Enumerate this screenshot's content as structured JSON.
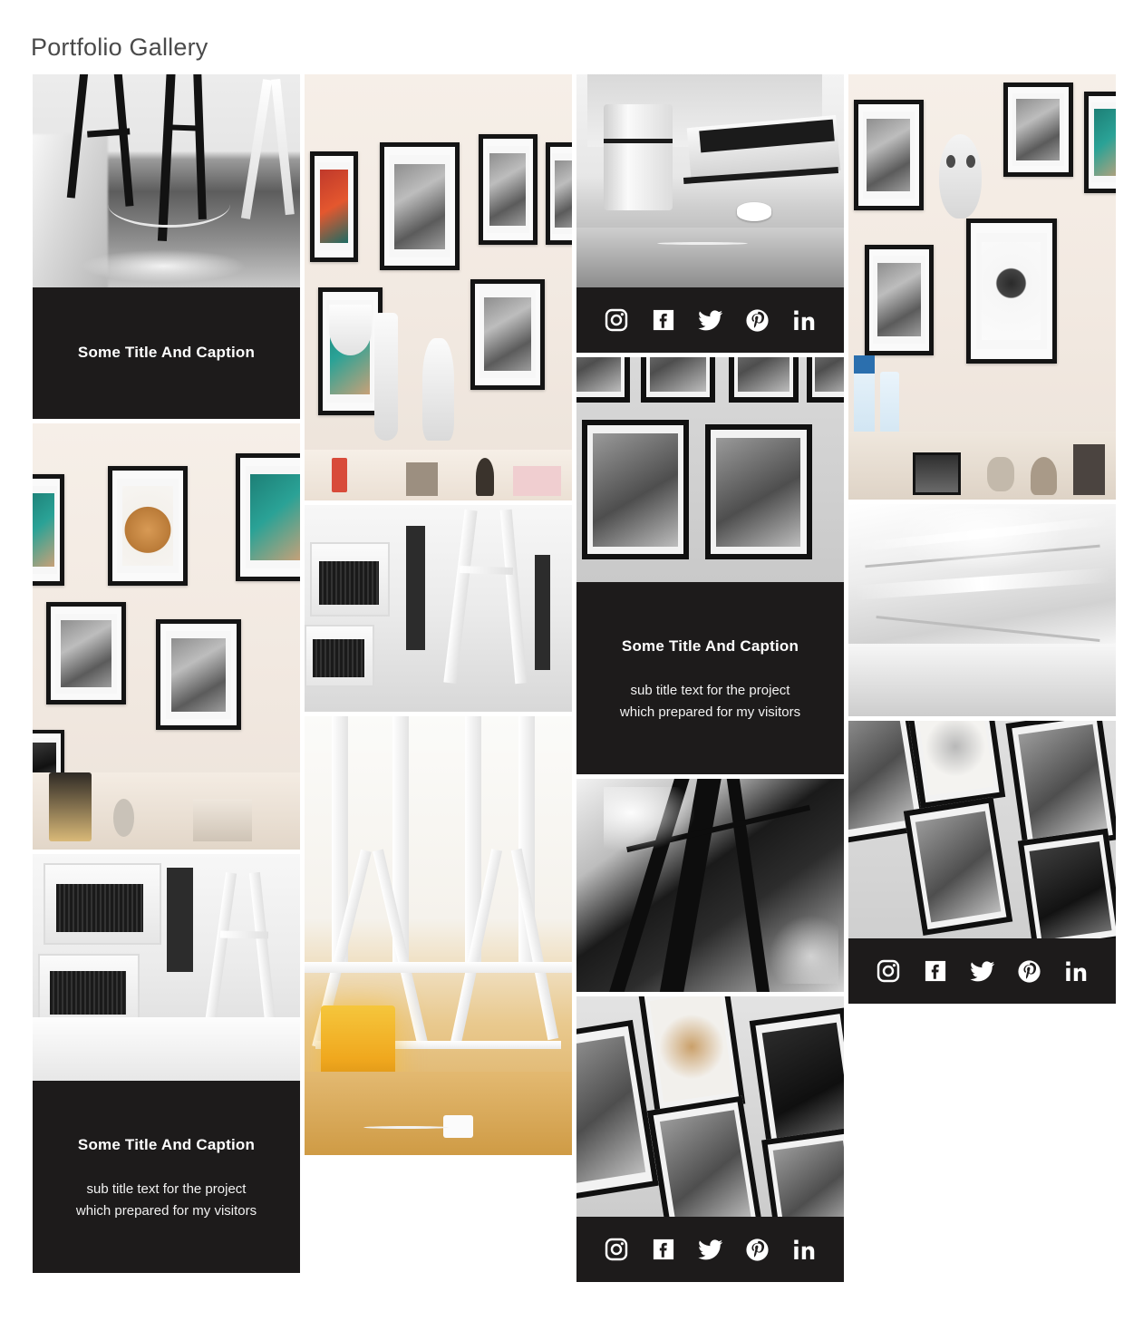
{
  "page": {
    "title": "Portfolio Gallery",
    "background_color": "#ffffff",
    "title_color": "#4a4a4a",
    "overlay_color": "#1d1b1b",
    "overlay_text_color": "#ffffff"
  },
  "caption": {
    "title": "Some Title And Caption",
    "subtitle_line1": "sub title text for the project",
    "subtitle_line2": "which prepared for my visitors"
  },
  "social": {
    "items": [
      {
        "name": "instagram-icon",
        "label": "Instagram"
      },
      {
        "name": "facebook-icon",
        "label": "Facebook"
      },
      {
        "name": "twitter-icon",
        "label": "Twitter"
      },
      {
        "name": "pinterest-icon",
        "label": "Pinterest"
      },
      {
        "name": "linkedin-icon",
        "label": "LinkedIn"
      }
    ]
  },
  "gallery": {
    "columns": [
      {
        "index": 1,
        "items": [
          {
            "type": "image-with-caption",
            "alt": "Black and white photo of stool legs and cable on a wooden floor",
            "overlay": "caption-title-only"
          },
          {
            "type": "image",
            "alt": "Gallery wall with motorcycle posters, gloves print and Moto Hero magazine"
          },
          {
            "type": "image-with-caption",
            "alt": "Black and white photo of guitar amplifier and white trestle desk",
            "overlay": "caption-title-and-subtitle"
          }
        ]
      },
      {
        "index": 2,
        "items": [
          {
            "type": "image",
            "alt": "Gallery wall with framed motorcycle art, red poster and desk lamp"
          },
          {
            "type": "image",
            "alt": "Black and white photo of amplifier beside a white trestle leg"
          },
          {
            "type": "image",
            "alt": "Desk with glowing yellow lamp under a white trestle table"
          }
        ]
      },
      {
        "index": 3,
        "items": [
          {
            "type": "image-with-social",
            "alt": "Black and white photo of an iMac stand and keyboard on a desk",
            "overlay": "social-bar"
          },
          {
            "type": "image-with-caption",
            "alt": "Black and white framed motorcycle photographs on a wall",
            "overlay": "caption-title-and-subtitle"
          },
          {
            "type": "image",
            "alt": "Black and white abstract of dark table legs and bright light"
          },
          {
            "type": "image-with-social",
            "alt": "Black and white diagonal arrangement of framed prints",
            "overlay": "social-bar"
          }
        ]
      },
      {
        "index": 4,
        "items": [
          {
            "type": "image",
            "alt": "Gallery wall with urinal, skull print and motorcycle posters"
          },
          {
            "type": "image",
            "alt": "Bright white abstract of a curved metal surface"
          },
          {
            "type": "image-with-social",
            "alt": "Black and white diagonal frames with gloves and motorcycle prints",
            "overlay": "social-bar"
          }
        ]
      }
    ]
  }
}
